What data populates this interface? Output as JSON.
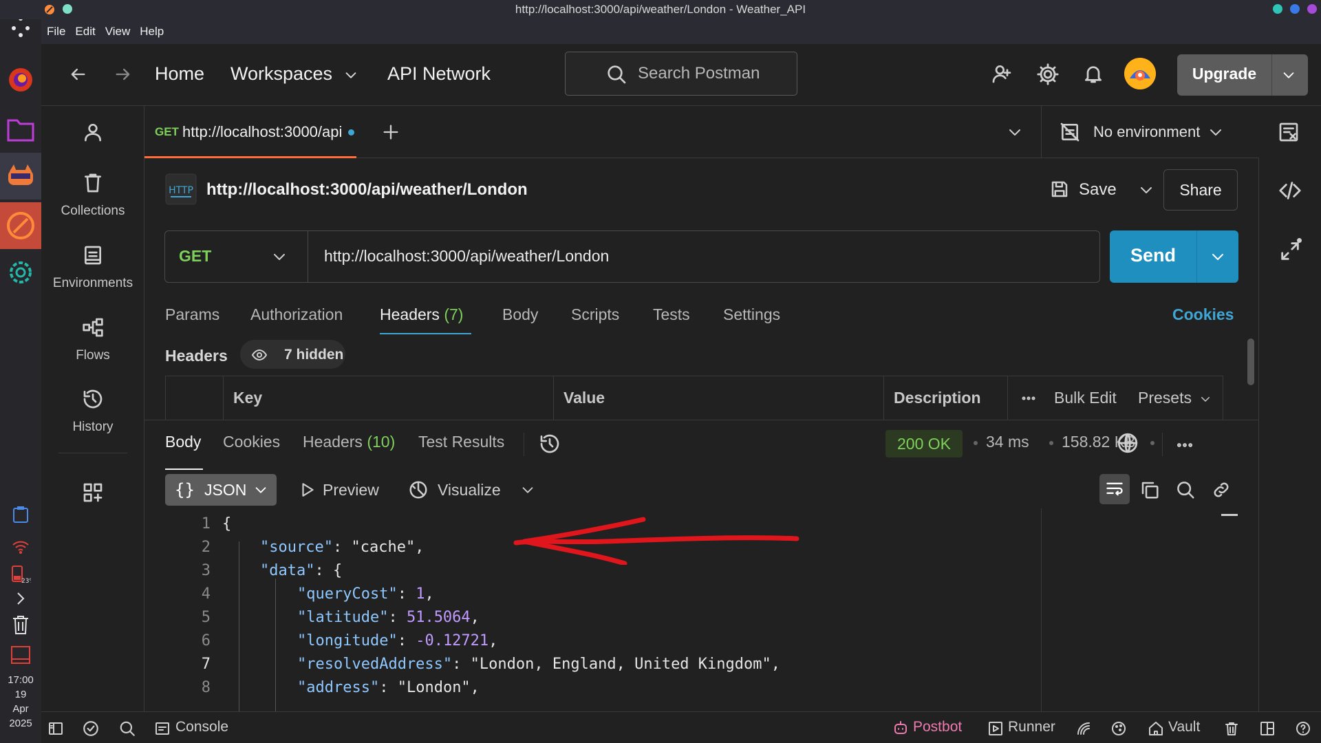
{
  "window": {
    "title": "http://localhost:3000/api/weather/London - Weather_API"
  },
  "menu": [
    "File",
    "Edit",
    "View",
    "Help"
  ],
  "header": {
    "home": "Home",
    "workspaces": "Workspaces",
    "api_network": "API Network",
    "search_placeholder": "Search Postman",
    "upgrade": "Upgrade"
  },
  "sidebar": {
    "items": [
      {
        "label": "Collections"
      },
      {
        "label": "Environments"
      },
      {
        "label": "Flows"
      },
      {
        "label": "History"
      }
    ]
  },
  "tab": {
    "method": "GET",
    "url": "http://localhost:3000/api/weather/London"
  },
  "environment": {
    "label": "No environment"
  },
  "request": {
    "name": "http://localhost:3000/api/weather/London",
    "save": "Save",
    "share": "Share",
    "method": "GET",
    "url": "http://localhost:3000/api/weather/London",
    "send": "Send",
    "tabs": {
      "params": "Params",
      "authorization": "Authorization",
      "headers": "Headers",
      "headers_count": "(7)",
      "body": "Body",
      "scripts": "Scripts",
      "tests": "Tests",
      "settings": "Settings"
    },
    "cookies": "Cookies",
    "headers_label": "Headers",
    "hidden": "7 hidden",
    "table": {
      "key": "Key",
      "value": "Value",
      "description": "Description",
      "bulk_edit": "Bulk Edit",
      "presets": "Presets"
    }
  },
  "response": {
    "tabs": {
      "body": "Body",
      "cookies": "Cookies",
      "headers": "Headers",
      "headers_count": "(10)",
      "test_results": "Test Results"
    },
    "status": "200 OK",
    "time": "34 ms",
    "size": "158.82 KB",
    "format": "JSON",
    "preview": "Preview",
    "visualize": "Visualize",
    "lines": [
      {
        "n": "1",
        "key": "",
        "val": "{"
      },
      {
        "n": "2",
        "key": "\"source\"",
        "val": "\"cache\","
      },
      {
        "n": "3",
        "key": "\"data\"",
        "val": "{"
      },
      {
        "n": "4",
        "key": "\"queryCost\"",
        "val": "1"
      },
      {
        "n": "5",
        "key": "\"latitude\"",
        "val": "51.5064"
      },
      {
        "n": "6",
        "key": "\"longitude\"",
        "val": "-0.12721"
      },
      {
        "n": "7",
        "key": "\"resolvedAddress\"",
        "val": "\"London, England, United Kingdom\","
      },
      {
        "n": "8",
        "key": "\"address\"",
        "val": "\"London\","
      }
    ]
  },
  "statusbar": {
    "console": "Console",
    "postbot": "Postbot",
    "runner": "Runner",
    "vault": "Vault"
  },
  "clock": {
    "time": "17:00",
    "day": "19",
    "month": "Apr",
    "year": "2025"
  },
  "annotation_color": "#e0161c"
}
